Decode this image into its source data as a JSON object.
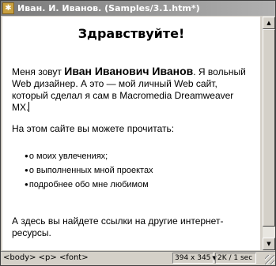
{
  "window": {
    "title": "Иван. И. Иванов. (Samples/3.1.htm*)",
    "icon": "dreamweaver-doc-icon"
  },
  "document": {
    "heading": "Здравствуйте!",
    "intro_before": "Меня зовут ",
    "intro_name": "Иван Иванович Иванов",
    "intro_after": ". Я вольный Web дизайнер. А это — мой личный Web сайт, который сделал я сам в Macromedia Dreamweaver MX.",
    "read_intro": "На этом сайте вы можете прочитать:",
    "bullets": [
      "о моих увлечениях;",
      "о выполненных мной проектах",
      "подробнее обо мне любимом"
    ],
    "links_para": "А здесь вы найдете ссылки на другие интернет-ресурсы."
  },
  "statusbar": {
    "tag_selector": "<body> <p> <font>",
    "window_size": "394 x 345",
    "download": "2K / 1 sec"
  }
}
